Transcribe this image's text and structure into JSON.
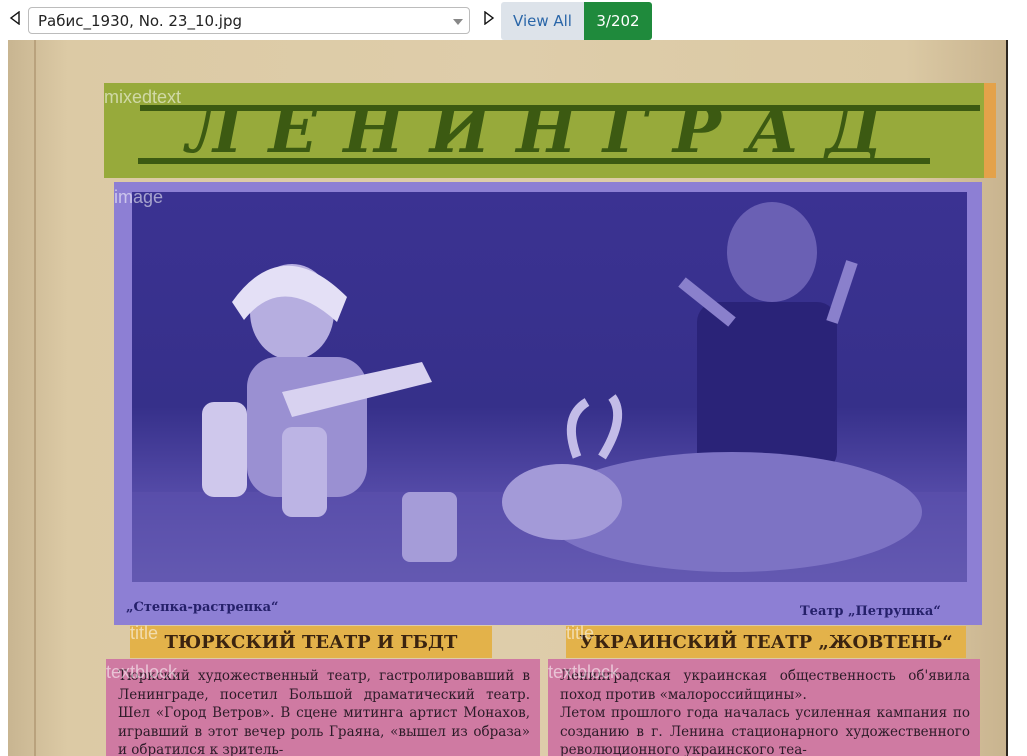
{
  "toolbar": {
    "file_name": "Рабис_1930, No. 23_10.jpg",
    "view_all_label": "View All",
    "counter": "3/202",
    "prev_icon": "triangle-left-icon",
    "next_icon": "triangle-right-icon",
    "dropdown_icon": "caret-down-icon"
  },
  "colors": {
    "mixedtext": "#97aa3b",
    "image": "#8d7fd4",
    "title": "#e3b24a",
    "textblock": "#cf7aa2",
    "counter_bg": "#1f8a3c",
    "view_all_bg": "#dde3ea"
  },
  "regions": {
    "mixedtext": {
      "label": "mixedtext",
      "content": "ЛЕНИНГРАД"
    },
    "image": {
      "label": "image",
      "caption_left": "„Степка-растрепка“",
      "caption_right": "Театр „Петрушка“"
    },
    "title_left": {
      "label": "title",
      "text": "ТЮРКСКИЙ ТЕАТР И ГБДТ"
    },
    "title_right": {
      "label": "title",
      "text": "УКРАИНСКИЙ ТЕАТР „ЖОВТЕНЬ“"
    },
    "textblock_left": {
      "label": "textblock",
      "text": "Тюркский художественный театр, гастролировавший в Ленинграде, посетил Большой драматический театр. Шел «Город Ветров». В сцене митинга артист Монахов, игравший в этот вечер роль Граяна, «вышел из образа» и обратился к зритель-"
    },
    "textblock_right": {
      "label": "textblock",
      "text": "Ленинградская украинская общественность об'явила поход против «малороссийщины».\nЛетом прошлого года началась усиленная кампания по созданию в г. Ленина стационарного художественного революционного украинского теа-"
    }
  }
}
